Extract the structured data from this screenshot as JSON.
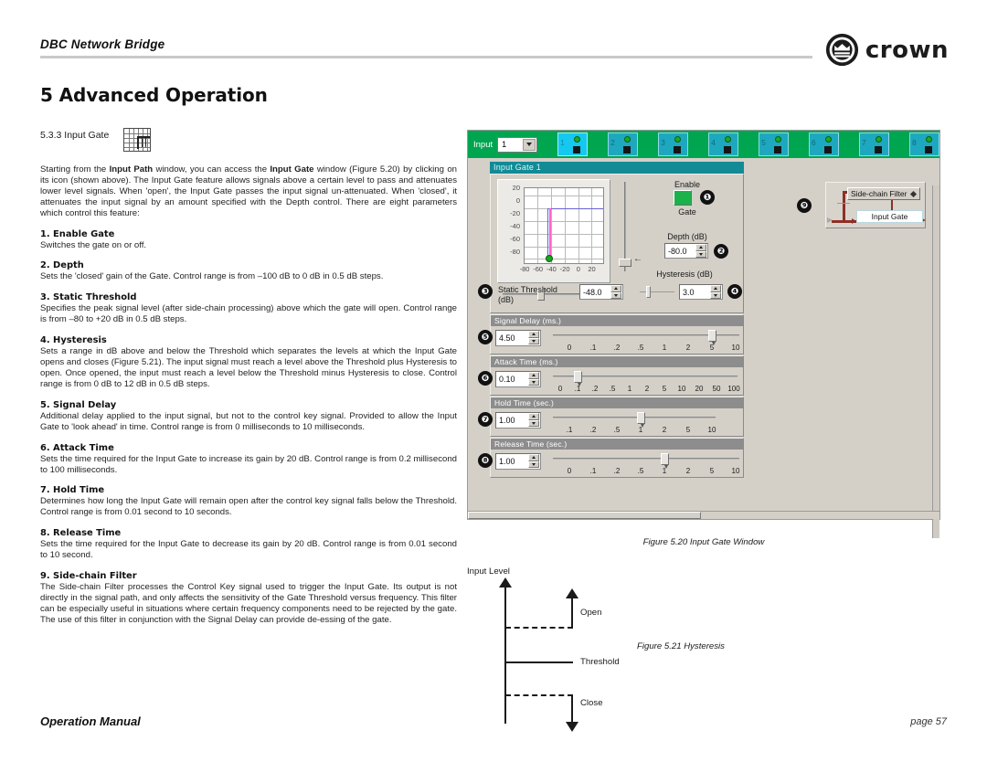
{
  "header": {
    "document_title": "DBC Network Bridge",
    "brand": "crown",
    "brand_icon": "crown-emblem-icon"
  },
  "chapter": {
    "title": "5 Advanced Operation"
  },
  "section": {
    "number_label": "5.3.3 Input Gate",
    "icon": "input-gate-grid-icon",
    "intro": "Starting from the <b>Input Path</b> window, you can access the <b>Input Gate</b> window (Figure 5.20) by clicking on its icon (shown above). The Input Gate feature allows signals above a certain level to pass and attenuates lower level signals. When 'open', the Input Gate passes the input signal un-attenuated. When 'closed', it attenuates the input signal by an amount specified with the Depth control. There are eight parameters which control this feature:",
    "parameters": [
      {
        "title": "1. Enable Gate",
        "body": "Switches the gate on or off."
      },
      {
        "title": "2. Depth",
        "body": "Sets the 'closed' gain of the Gate. Control range is from –100 dB to 0 dB in 0.5 dB steps."
      },
      {
        "title": "3. Static Threshold",
        "body": "Specifies the peak signal level (after side-chain processing) above which the gate will open. Control range is from –80 to +20 dB in 0.5 dB steps."
      },
      {
        "title": "4. Hysteresis",
        "body": "Sets a range in dB above and below the Threshold which separates the levels at which the Input Gate opens and closes (Figure 5.21). The input signal must reach a level above the Threshold plus Hysteresis to open. Once opened, the input must reach a level below the Threshold minus Hysteresis to close. Control range is from 0 dB to 12 dB in 0.5 dB steps."
      },
      {
        "title": "5. Signal Delay",
        "body": "Additional delay applied to the input signal, but not to the control key signal. Provided to allow the Input Gate to 'look ahead' in time. Control range is from 0 milliseconds to 10 milliseconds."
      },
      {
        "title": "6. Attack Time",
        "body": "Sets the time required for the Input Gate to increase its gain by 20 dB. Control range is from 0.2 millisecond to 100 milliseconds."
      },
      {
        "title": "7. Hold Time",
        "body": "Determines how long the Input Gate will remain open after the control key signal falls below the Threshold. Control range is from 0.01 second to 10 seconds."
      },
      {
        "title": "8. Release Time",
        "body": "Sets the time required for the Input Gate to decrease its gain by 20 dB. Control range is from 0.01 second to 10 second."
      },
      {
        "title": "9. Side-chain Filter",
        "body": "The Side-chain Filter processes the Control Key signal used to trigger the Input Gate. Its output is not directly in the signal path, and only affects the sensitivity of the Gate Threshold versus frequency. This filter can be especially useful in situations where certain frequency components need to be rejected by the gate. The use of this filter in conjunction with the Signal Delay can provide de-essing of the gate."
      }
    ]
  },
  "app": {
    "channel_bar": {
      "input_label": "Input",
      "input_select_value": "1",
      "channels": [
        "1",
        "2",
        "3",
        "4",
        "5",
        "6",
        "7",
        "8"
      ],
      "active_channel": "1",
      "bar_color": "#00a550",
      "channel_color": "#1ea8bf",
      "active_channel_color": "#14c8f0",
      "led_color": "#1aab22"
    },
    "window_title": "Input Gate 1",
    "titlebar_color": "#128b96",
    "graph": {
      "y_ticks": [
        "20",
        "0",
        "-20",
        "-40",
        "-60",
        "-80"
      ],
      "x_ticks": [
        "-80",
        "-60",
        "-40",
        "-20",
        "0",
        "20"
      ],
      "curve_color": "#ff63c8",
      "curve_color_secondary": "#6a62d8",
      "marker_color": "#17a81f"
    },
    "enable": {
      "label_top": "Enable",
      "label_bottom": "Gate",
      "state_color": "#1ab24a",
      "callout": "❶"
    },
    "depth": {
      "label": "Depth (dB)",
      "value": "-80.0",
      "callout": "❷"
    },
    "static_threshold": {
      "label": "Static Threshold (dB)",
      "label_line1": "Static Threshold",
      "label_line2": "(dB)",
      "value": "-48.0",
      "callout": "❸"
    },
    "hysteresis": {
      "label": "Hysteresis (dB)",
      "value": "3.0",
      "callout": "❹"
    },
    "sliders": [
      {
        "title": "Signal Delay (ms.)",
        "value": "4.50",
        "ticks": [
          "0",
          ".1",
          ".2",
          ".5",
          "1",
          "2",
          "5",
          "10"
        ],
        "knob_tick_index": 6,
        "callout": "❺"
      },
      {
        "title": "Attack Time (ms.)",
        "value": "0.10",
        "ticks": [
          "0",
          ".1",
          ".2",
          ".5",
          "1",
          "2",
          "5",
          "10",
          "20",
          "50",
          "100"
        ],
        "knob_tick_index": 1,
        "callout": "❻"
      },
      {
        "title": "Hold Time (sec.)",
        "value": "1.00",
        "ticks": [
          ".1",
          ".2",
          ".5",
          "1",
          "2",
          "5",
          "10"
        ],
        "knob_tick_index": 3,
        "callout": "❼"
      },
      {
        "title": "Release Time (sec.)",
        "value": "1.00",
        "ticks": [
          "0",
          ".1",
          ".2",
          ".5",
          "1",
          "2",
          "5",
          "10"
        ],
        "knob_tick_index": 4,
        "callout": "❽"
      }
    ],
    "sidechain": {
      "filter_button": "Side-chain Filter",
      "gate_button": "Input Gate",
      "callout": "❸̸",
      "callout_number": "❾",
      "wire_color": "#8d2f26"
    }
  },
  "figures": {
    "fig_520_caption": "Figure 5.20  Input Gate Window",
    "fig_521_caption": "Figure 5.21  Hysteresis",
    "hysteresis_diagram": {
      "axis_label": "Input Level",
      "open_label": "Open",
      "threshold_label": "Threshold",
      "close_label": "Close"
    }
  },
  "footer": {
    "left": "Operation Manual",
    "right": "page 57"
  }
}
